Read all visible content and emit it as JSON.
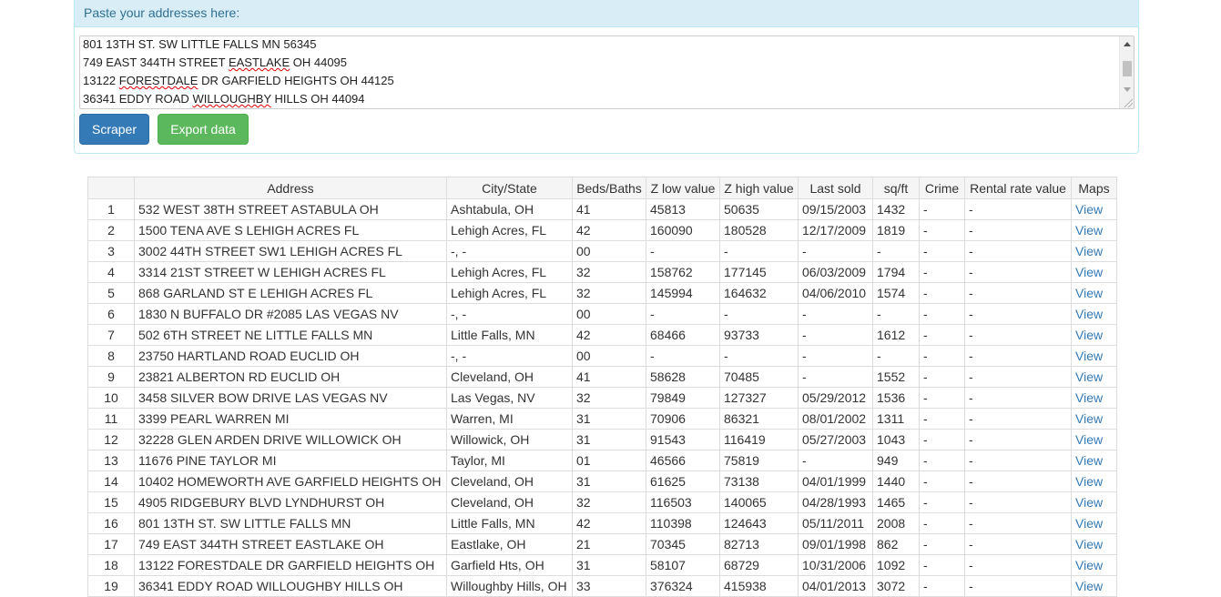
{
  "panel": {
    "heading": "Paste your addresses here:",
    "address_lines": [
      "801 13TH ST. SW LITTLE FALLS MN 56345",
      "749 EAST 344TH STREET EASTLAKE OH 44095",
      "13122 FORESTDALE DR GARFIELD HEIGHTS OH 44125",
      "36341 EDDY ROAD WILLOUGHBY HILLS OH 44094"
    ],
    "scraper_label": "Scraper",
    "export_label": "Export data"
  },
  "table": {
    "headers": [
      "",
      "Address",
      "City/State",
      "Beds/Baths",
      "Z low value",
      "Z high value",
      "Last sold",
      "sq/ft",
      "Crime",
      "Rental rate value",
      "Maps"
    ],
    "rows": [
      [
        "1",
        "532 WEST 38TH STREET ASTABULA OH",
        "Ashtabula, OH",
        "41",
        "45813",
        "50635",
        "09/15/2003",
        "1432",
        "-",
        "-",
        "View"
      ],
      [
        "2",
        "1500 TENA AVE S LEHIGH ACRES FL",
        "Lehigh Acres, FL",
        "42",
        "160090",
        "180528",
        "12/17/2009",
        "1819",
        "-",
        "-",
        "View"
      ],
      [
        "3",
        "3002 44TH STREET SW1 LEHIGH ACRES FL",
        "-, -",
        "00",
        "-",
        "-",
        "-",
        "-",
        "-",
        "-",
        "View"
      ],
      [
        "4",
        "3314 21ST STREET W LEHIGH ACRES FL",
        "Lehigh Acres, FL",
        "32",
        "158762",
        "177145",
        "06/03/2009",
        "1794",
        "-",
        "-",
        "View"
      ],
      [
        "5",
        "868 GARLAND ST E LEHIGH ACRES FL",
        "Lehigh Acres, FL",
        "32",
        "145994",
        "164632",
        "04/06/2010",
        "1574",
        "-",
        "-",
        "View"
      ],
      [
        "6",
        "1830 N BUFFALO DR #2085 LAS VEGAS NV",
        "-, -",
        "00",
        "-",
        "-",
        "-",
        "-",
        "-",
        "-",
        "View"
      ],
      [
        "7",
        "502 6TH STREET NE LITTLE FALLS MN",
        "Little Falls, MN",
        "42",
        "68466",
        "93733",
        "-",
        "1612",
        "-",
        "-",
        "View"
      ],
      [
        "8",
        "23750 HARTLAND ROAD EUCLID OH",
        "-, -",
        "00",
        "-",
        "-",
        "-",
        "-",
        "-",
        "-",
        "View"
      ],
      [
        "9",
        "23821 ALBERTON RD EUCLID OH",
        "Cleveland, OH",
        "41",
        "58628",
        "70485",
        "-",
        "1552",
        "-",
        "-",
        "View"
      ],
      [
        "10",
        "3458 SILVER BOW DRIVE LAS VEGAS NV",
        "Las Vegas, NV",
        "32",
        "79849",
        "127327",
        "05/29/2012",
        "1536",
        "-",
        "-",
        "View"
      ],
      [
        "11",
        "3399 PEARL WARREN MI",
        "Warren, MI",
        "31",
        "70906",
        "86321",
        "08/01/2002",
        "1311",
        "-",
        "-",
        "View"
      ],
      [
        "12",
        "32228 GLEN ARDEN DRIVE WILLOWICK OH",
        "Willowick, OH",
        "31",
        "91543",
        "116419",
        "05/27/2003",
        "1043",
        "-",
        "-",
        "View"
      ],
      [
        "13",
        "11676 PINE TAYLOR MI",
        "Taylor, MI",
        "01",
        "46566",
        "75819",
        "-",
        "949",
        "-",
        "-",
        "View"
      ],
      [
        "14",
        "10402 HOMEWORTH AVE GARFIELD HEIGHTS OH",
        "Cleveland, OH",
        "31",
        "61625",
        "73138",
        "04/01/1999",
        "1440",
        "-",
        "-",
        "View"
      ],
      [
        "15",
        "4905 RIDGEBURY BLVD LYNDHURST OH",
        "Cleveland, OH",
        "32",
        "116503",
        "140065",
        "04/28/1993",
        "1465",
        "-",
        "-",
        "View"
      ],
      [
        "16",
        "801 13TH ST. SW LITTLE FALLS MN",
        "Little Falls, MN",
        "42",
        "110398",
        "124643",
        "05/11/2011",
        "2008",
        "-",
        "-",
        "View"
      ],
      [
        "17",
        "749 EAST 344TH STREET EASTLAKE OH",
        "Eastlake, OH",
        "21",
        "70345",
        "82713",
        "09/01/1998",
        "862",
        "-",
        "-",
        "View"
      ],
      [
        "18",
        "13122 FORESTDALE DR GARFIELD HEIGHTS OH",
        "Garfield Hts, OH",
        "31",
        "58107",
        "68729",
        "10/31/2006",
        "1092",
        "-",
        "-",
        "View"
      ],
      [
        "19",
        "36341 EDDY ROAD WILLOUGHBY HILLS OH",
        "Willoughby Hills, OH",
        "33",
        "376324",
        "415938",
        "04/01/2013",
        "3072",
        "-",
        "-",
        "View"
      ]
    ]
  },
  "colors": {
    "panel_heading_bg": "#d9edf7",
    "panel_heading_text": "#31708f",
    "primary_button": "#337ab7",
    "success_button": "#5cb85c",
    "link": "#337ab7"
  },
  "icons": {
    "scroll_up": "scroll-up-arrow-icon",
    "scroll_down": "scroll-down-arrow-icon",
    "resize": "resize-grip-icon"
  }
}
